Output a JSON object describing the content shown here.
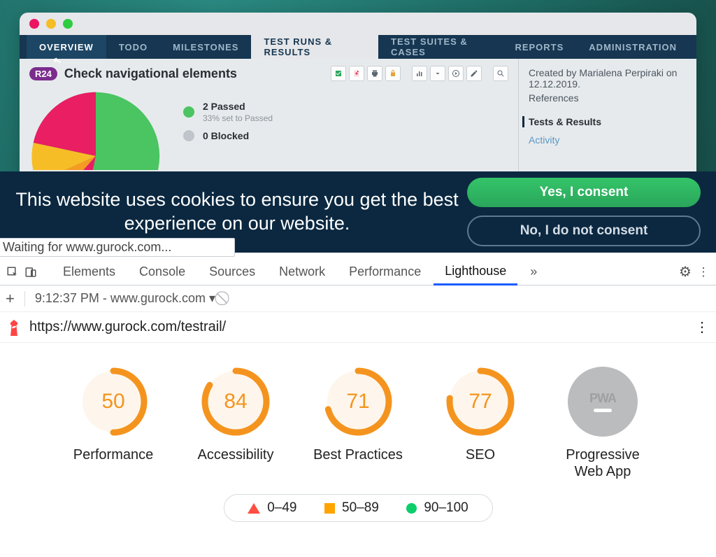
{
  "window": {
    "tabs": {
      "overview": "OVERVIEW",
      "todo": "TODO",
      "milestones": "MILESTONES",
      "runs": "TEST RUNS & RESULTS",
      "suites": "TEST SUITES & CASES",
      "reports": "REPORTS",
      "admin": "ADMINISTRATION"
    },
    "run": {
      "badge": "R24",
      "title": "Check navigational elements"
    },
    "legend": {
      "passed_title": "2 Passed",
      "passed_sub": "33% set to Passed",
      "blocked_title": "0 Blocked"
    },
    "sidebar": {
      "created": "Created by Marialena Perpiraki on 12.12.2019.",
      "references": "References",
      "tests_results": "Tests & Results",
      "activity": "Activity"
    }
  },
  "chart_data": {
    "type": "pie",
    "title": "",
    "series": [
      {
        "name": "Passed",
        "value": 33,
        "color": "#4ac561"
      },
      {
        "name": "Failed",
        "value": 47,
        "color": "#e91e63"
      },
      {
        "name": "Blocked",
        "value": 10,
        "color": "#f6bd27"
      },
      {
        "name": "Retest",
        "value": 10,
        "color": "#f59a23"
      }
    ]
  },
  "cookie": {
    "text": "This website uses cookies to ensure you get the best experience on our website.",
    "yes": "Yes, I consent",
    "no": "No, I do not consent"
  },
  "status_chip": "Waiting for www.gurock.com...",
  "devtools": {
    "tabs": {
      "elements": "Elements",
      "console": "Console",
      "sources": "Sources",
      "network": "Network",
      "performance": "Performance",
      "lighthouse": "Lighthouse"
    },
    "sub": {
      "time_host": "9:12:37 PM - www.gurock.com"
    },
    "url": "https://www.gurock.com/testrail/"
  },
  "lighthouse": {
    "scores": {
      "performance": {
        "value": "50",
        "label": "Performance"
      },
      "accessibility": {
        "value": "84",
        "label": "Accessibility"
      },
      "best": {
        "value": "71",
        "label": "Best Practices"
      },
      "seo": {
        "value": "77",
        "label": "SEO"
      },
      "pwa": {
        "label": "Progressive Web App"
      }
    },
    "legend": {
      "low": "0–49",
      "mid": "50–89",
      "high": "90–100"
    }
  }
}
